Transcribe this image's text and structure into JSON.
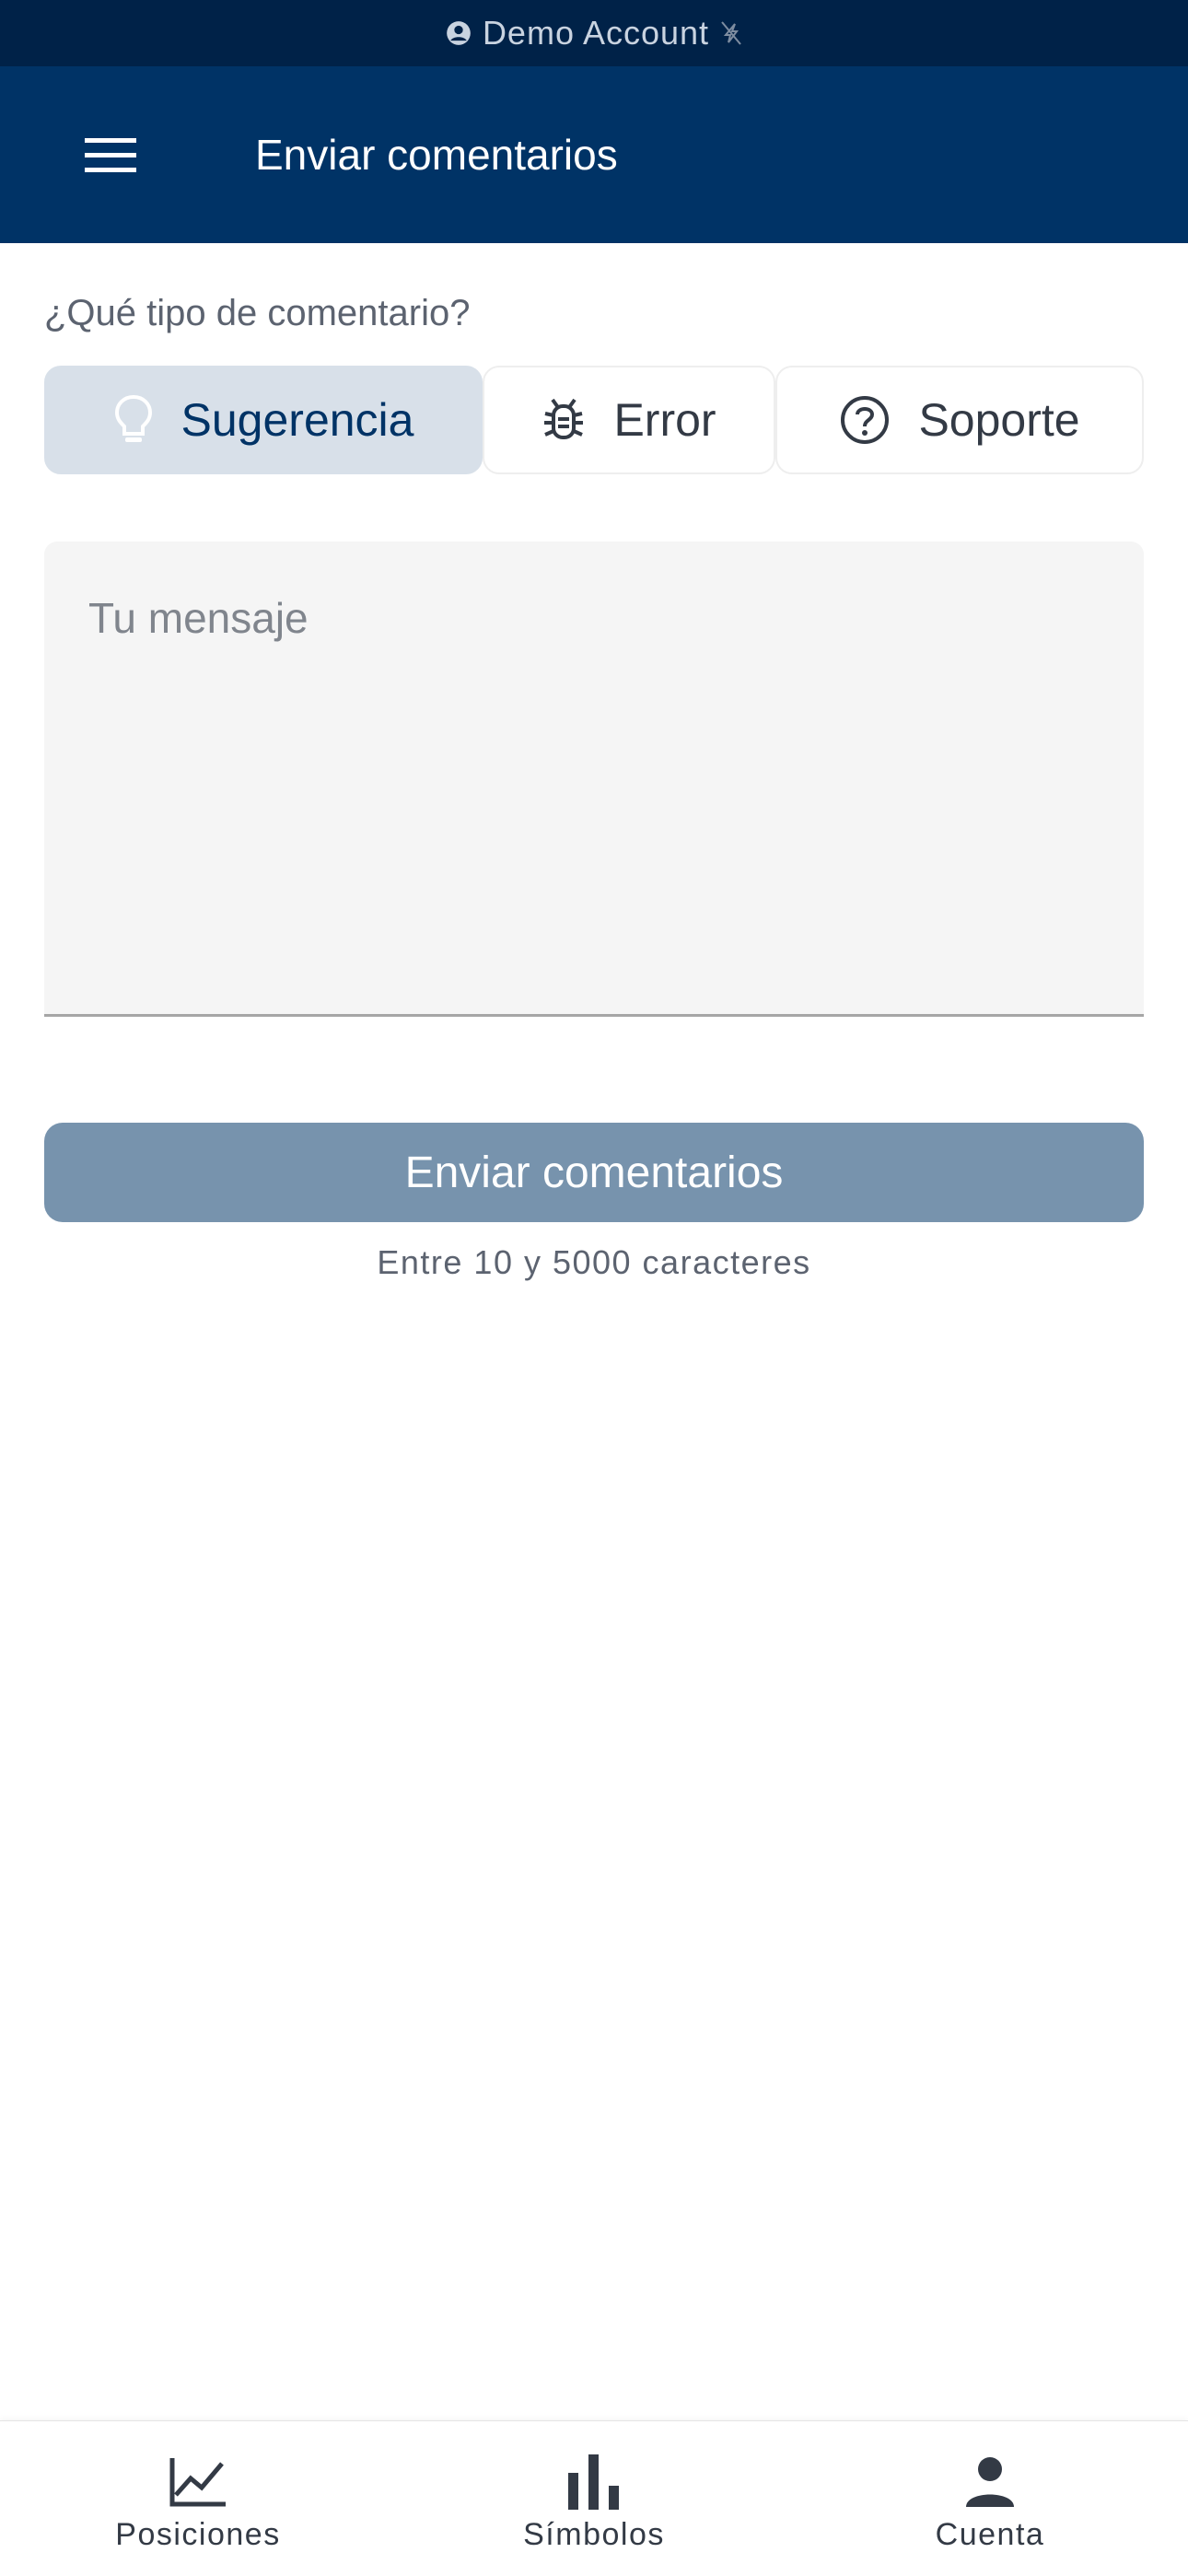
{
  "status_bar": {
    "account_label": "Demo Account",
    "icons": [
      "account-circle-icon",
      "signal-off-icon"
    ]
  },
  "app_bar": {
    "menu_icon": "menu-icon",
    "title": "Enviar comentarios"
  },
  "feedback_form": {
    "type_label": "¿Qué tipo de comentario?",
    "types": [
      {
        "label": "Sugerencia",
        "icon": "lightbulb-icon",
        "selected": true
      },
      {
        "label": "Error",
        "icon": "bug-icon",
        "selected": false
      },
      {
        "label": "Soporte",
        "icon": "help-circle-icon",
        "selected": false
      }
    ],
    "message_placeholder": "Tu mensaje",
    "message_value": "",
    "submit_label": "Enviar comentarios",
    "length_hint": "Entre 10 y 5000 caracteres"
  },
  "bottom_nav": {
    "items": [
      {
        "label": "Posiciones",
        "icon": "line-chart-icon"
      },
      {
        "label": "Símbolos",
        "icon": "bar-chart-icon"
      },
      {
        "label": "Cuenta",
        "icon": "person-icon"
      }
    ]
  },
  "colors": {
    "status_bar_bg": "#002248",
    "app_bar_bg": "#003366",
    "selected_segment_bg": "#d8e0e9",
    "submit_button_bg": "#7793ad",
    "input_bg": "#f5f5f5"
  }
}
